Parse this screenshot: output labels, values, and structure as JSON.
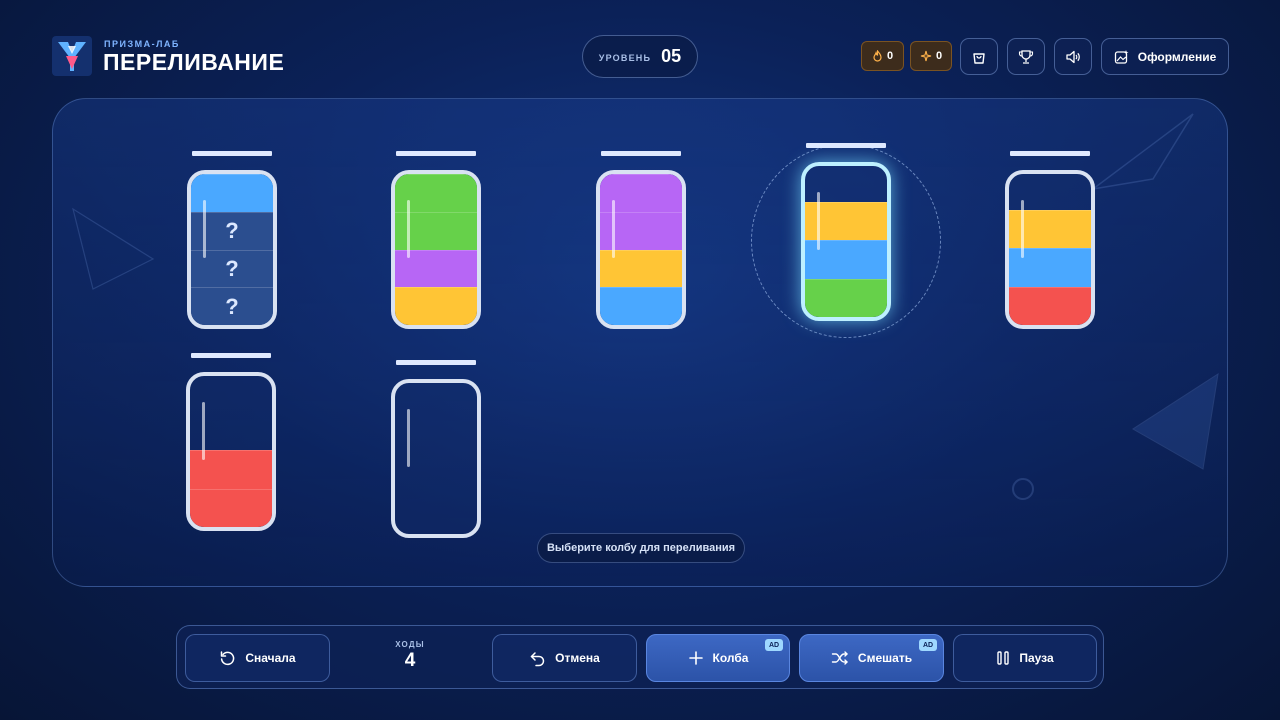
{
  "header": {
    "brand_sub": "ПРИЗМА-ЛАБ",
    "title": "ПЕРЕЛИВАНИЕ",
    "level_label": "УРОВЕНЬ",
    "level_value": "05",
    "fire_count": "0",
    "spark_count": "0",
    "theme_label": "Оформление"
  },
  "colors": {
    "blue": "#4aa8ff",
    "green": "#66d14a",
    "purple": "#b766f5",
    "yellow": "#ffc535",
    "red": "#f4524f",
    "hidden": "#2b4e8f"
  },
  "flasks": [
    {
      "name": "flask-1",
      "layers_top_to_bottom": [
        "blue",
        "hidden",
        "hidden",
        "hidden"
      ],
      "hidden_mark": "?",
      "selected": false
    },
    {
      "name": "flask-2",
      "layers_top_to_bottom": [
        "green",
        "green",
        "purple",
        "yellow"
      ],
      "selected": false
    },
    {
      "name": "flask-3",
      "layers_top_to_bottom": [
        "purple",
        "purple",
        "yellow",
        "blue"
      ],
      "selected": false
    },
    {
      "name": "flask-4",
      "layers_top_to_bottom": [
        "yellow",
        "blue",
        "green"
      ],
      "selected": true
    },
    {
      "name": "flask-5",
      "layers_top_to_bottom": [
        "yellow",
        "blue",
        "red"
      ],
      "selected": false
    },
    {
      "name": "flask-6",
      "layers_top_to_bottom": [
        "red",
        "red"
      ],
      "selected": false
    },
    {
      "name": "flask-7",
      "layers_top_to_bottom": [],
      "selected": false
    }
  ],
  "hint": "Выберите колбу для переливания",
  "toolbar": {
    "restart_label": "Сначала",
    "moves_label": "ХОДЫ",
    "moves_value": "4",
    "undo_label": "Отмена",
    "add_flask_label": "Колба",
    "shuffle_label": "Смешать",
    "ad_badge": "AD",
    "pause_label": "Пауза"
  }
}
